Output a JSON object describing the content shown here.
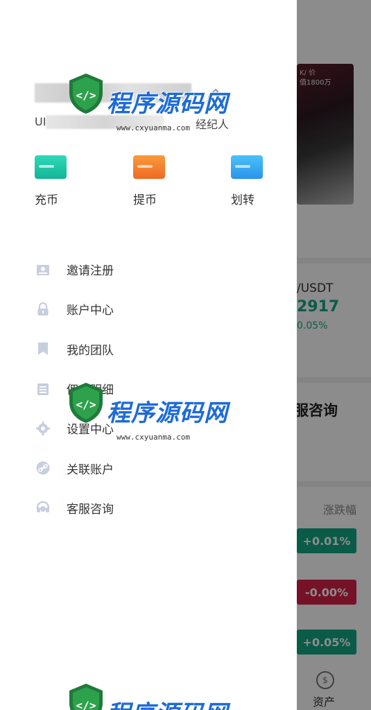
{
  "user": {
    "uid_prefix": "UI",
    "role": "经纪人"
  },
  "quick_actions": [
    {
      "label": "充币",
      "color": "#1fc7a8"
    },
    {
      "label": "提币",
      "color": "#f07a2a"
    },
    {
      "label": "划转",
      "color": "#39a7f2"
    }
  ],
  "menu": [
    {
      "label": "邀请注册",
      "icon": "id-card-icon"
    },
    {
      "label": "账户中心",
      "icon": "lock-icon"
    },
    {
      "label": "我的团队",
      "icon": "bookmark-icon"
    },
    {
      "label": "佣金明细",
      "icon": "list-icon"
    },
    {
      "label": "设置中心",
      "icon": "gear-icon"
    },
    {
      "label": "关联账户",
      "icon": "link-icon"
    },
    {
      "label": "客服咨询",
      "icon": "headset-icon"
    }
  ],
  "background": {
    "banner_line1": "K/ 价",
    "banner_line2": "值1800万",
    "pair": "/USDT",
    "price": "2917",
    "change": "0.05%",
    "service_title": "服咨询",
    "change_header": "涨跌幅",
    "badges": [
      {
        "text": "+0.01%",
        "color": "#13a683"
      },
      {
        "text": "-0.00%",
        "color": "#d6224a"
      },
      {
        "text": "+0.05%",
        "color": "#13a683"
      }
    ],
    "asset_icon": "$",
    "asset_label": "资产"
  },
  "watermark": {
    "text": "程序源码网",
    "url": "www.cxyuanma.com"
  }
}
